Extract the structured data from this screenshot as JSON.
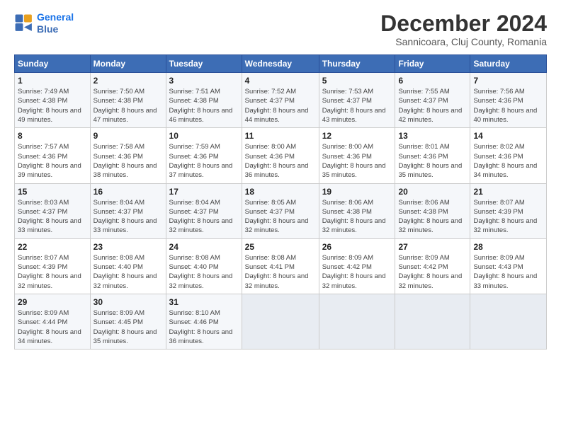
{
  "logo": {
    "line1": "General",
    "line2": "Blue"
  },
  "title": "December 2024",
  "subtitle": "Sannicoara, Cluj County, Romania",
  "header": {
    "days": [
      "Sunday",
      "Monday",
      "Tuesday",
      "Wednesday",
      "Thursday",
      "Friday",
      "Saturday"
    ]
  },
  "weeks": [
    [
      {
        "day": "1",
        "sunrise": "Sunrise: 7:49 AM",
        "sunset": "Sunset: 4:38 PM",
        "daylight": "Daylight: 8 hours and 49 minutes."
      },
      {
        "day": "2",
        "sunrise": "Sunrise: 7:50 AM",
        "sunset": "Sunset: 4:38 PM",
        "daylight": "Daylight: 8 hours and 47 minutes."
      },
      {
        "day": "3",
        "sunrise": "Sunrise: 7:51 AM",
        "sunset": "Sunset: 4:38 PM",
        "daylight": "Daylight: 8 hours and 46 minutes."
      },
      {
        "day": "4",
        "sunrise": "Sunrise: 7:52 AM",
        "sunset": "Sunset: 4:37 PM",
        "daylight": "Daylight: 8 hours and 44 minutes."
      },
      {
        "day": "5",
        "sunrise": "Sunrise: 7:53 AM",
        "sunset": "Sunset: 4:37 PM",
        "daylight": "Daylight: 8 hours and 43 minutes."
      },
      {
        "day": "6",
        "sunrise": "Sunrise: 7:55 AM",
        "sunset": "Sunset: 4:37 PM",
        "daylight": "Daylight: 8 hours and 42 minutes."
      },
      {
        "day": "7",
        "sunrise": "Sunrise: 7:56 AM",
        "sunset": "Sunset: 4:36 PM",
        "daylight": "Daylight: 8 hours and 40 minutes."
      }
    ],
    [
      {
        "day": "8",
        "sunrise": "Sunrise: 7:57 AM",
        "sunset": "Sunset: 4:36 PM",
        "daylight": "Daylight: 8 hours and 39 minutes."
      },
      {
        "day": "9",
        "sunrise": "Sunrise: 7:58 AM",
        "sunset": "Sunset: 4:36 PM",
        "daylight": "Daylight: 8 hours and 38 minutes."
      },
      {
        "day": "10",
        "sunrise": "Sunrise: 7:59 AM",
        "sunset": "Sunset: 4:36 PM",
        "daylight": "Daylight: 8 hours and 37 minutes."
      },
      {
        "day": "11",
        "sunrise": "Sunrise: 8:00 AM",
        "sunset": "Sunset: 4:36 PM",
        "daylight": "Daylight: 8 hours and 36 minutes."
      },
      {
        "day": "12",
        "sunrise": "Sunrise: 8:00 AM",
        "sunset": "Sunset: 4:36 PM",
        "daylight": "Daylight: 8 hours and 35 minutes."
      },
      {
        "day": "13",
        "sunrise": "Sunrise: 8:01 AM",
        "sunset": "Sunset: 4:36 PM",
        "daylight": "Daylight: 8 hours and 35 minutes."
      },
      {
        "day": "14",
        "sunrise": "Sunrise: 8:02 AM",
        "sunset": "Sunset: 4:36 PM",
        "daylight": "Daylight: 8 hours and 34 minutes."
      }
    ],
    [
      {
        "day": "15",
        "sunrise": "Sunrise: 8:03 AM",
        "sunset": "Sunset: 4:37 PM",
        "daylight": "Daylight: 8 hours and 33 minutes."
      },
      {
        "day": "16",
        "sunrise": "Sunrise: 8:04 AM",
        "sunset": "Sunset: 4:37 PM",
        "daylight": "Daylight: 8 hours and 33 minutes."
      },
      {
        "day": "17",
        "sunrise": "Sunrise: 8:04 AM",
        "sunset": "Sunset: 4:37 PM",
        "daylight": "Daylight: 8 hours and 32 minutes."
      },
      {
        "day": "18",
        "sunrise": "Sunrise: 8:05 AM",
        "sunset": "Sunset: 4:37 PM",
        "daylight": "Daylight: 8 hours and 32 minutes."
      },
      {
        "day": "19",
        "sunrise": "Sunrise: 8:06 AM",
        "sunset": "Sunset: 4:38 PM",
        "daylight": "Daylight: 8 hours and 32 minutes."
      },
      {
        "day": "20",
        "sunrise": "Sunrise: 8:06 AM",
        "sunset": "Sunset: 4:38 PM",
        "daylight": "Daylight: 8 hours and 32 minutes."
      },
      {
        "day": "21",
        "sunrise": "Sunrise: 8:07 AM",
        "sunset": "Sunset: 4:39 PM",
        "daylight": "Daylight: 8 hours and 32 minutes."
      }
    ],
    [
      {
        "day": "22",
        "sunrise": "Sunrise: 8:07 AM",
        "sunset": "Sunset: 4:39 PM",
        "daylight": "Daylight: 8 hours and 32 minutes."
      },
      {
        "day": "23",
        "sunrise": "Sunrise: 8:08 AM",
        "sunset": "Sunset: 4:40 PM",
        "daylight": "Daylight: 8 hours and 32 minutes."
      },
      {
        "day": "24",
        "sunrise": "Sunrise: 8:08 AM",
        "sunset": "Sunset: 4:40 PM",
        "daylight": "Daylight: 8 hours and 32 minutes."
      },
      {
        "day": "25",
        "sunrise": "Sunrise: 8:08 AM",
        "sunset": "Sunset: 4:41 PM",
        "daylight": "Daylight: 8 hours and 32 minutes."
      },
      {
        "day": "26",
        "sunrise": "Sunrise: 8:09 AM",
        "sunset": "Sunset: 4:42 PM",
        "daylight": "Daylight: 8 hours and 32 minutes."
      },
      {
        "day": "27",
        "sunrise": "Sunrise: 8:09 AM",
        "sunset": "Sunset: 4:42 PM",
        "daylight": "Daylight: 8 hours and 32 minutes."
      },
      {
        "day": "28",
        "sunrise": "Sunrise: 8:09 AM",
        "sunset": "Sunset: 4:43 PM",
        "daylight": "Daylight: 8 hours and 33 minutes."
      }
    ],
    [
      {
        "day": "29",
        "sunrise": "Sunrise: 8:09 AM",
        "sunset": "Sunset: 4:44 PM",
        "daylight": "Daylight: 8 hours and 34 minutes."
      },
      {
        "day": "30",
        "sunrise": "Sunrise: 8:09 AM",
        "sunset": "Sunset: 4:45 PM",
        "daylight": "Daylight: 8 hours and 35 minutes."
      },
      {
        "day": "31",
        "sunrise": "Sunrise: 8:10 AM",
        "sunset": "Sunset: 4:46 PM",
        "daylight": "Daylight: 8 hours and 36 minutes."
      },
      null,
      null,
      null,
      null
    ]
  ]
}
